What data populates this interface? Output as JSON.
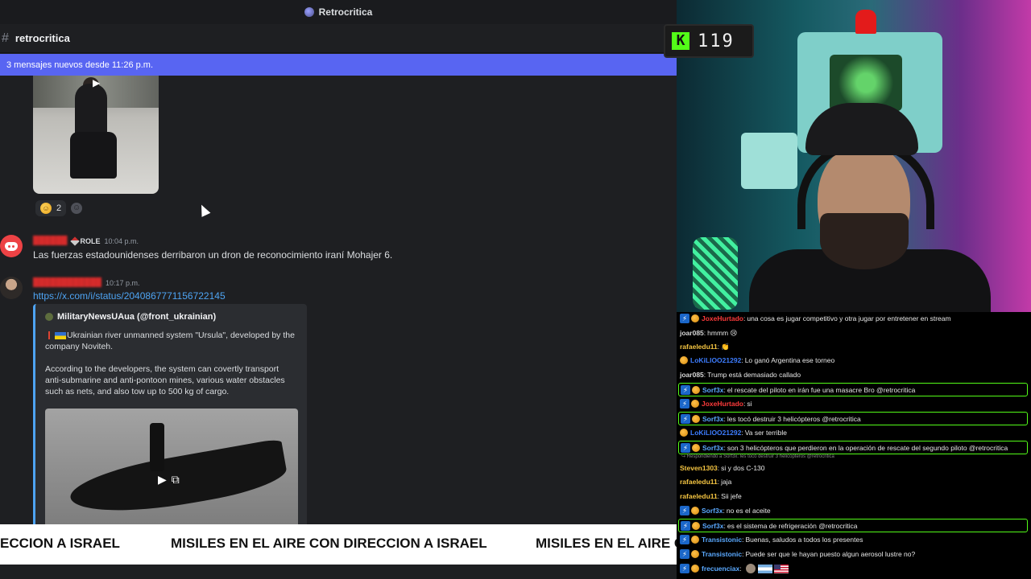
{
  "titlebar": {
    "title": "Retrocritica"
  },
  "channel": {
    "name": "retrocritica"
  },
  "new_banner": {
    "text": "3 mensajes nuevos desde 11:26 p.m."
  },
  "reactions": [
    {
      "emoji": "rofl",
      "count": "2"
    }
  ],
  "messages": [
    {
      "role": "ROLE",
      "time": "10:04 p.m.",
      "text": "Las fuerzas estadounidenses derribaron un dron de reconocimiento iraní Mohajer 6."
    },
    {
      "time": "10:17 p.m.",
      "link": "https://x.com/i/status/2040867771156722145",
      "embed": {
        "author": "MilitaryNewsUAua (@front_ukrainian)",
        "line1": "Ukrainian river unmanned system \"Ursula\", developed by the",
        "line2": "company Noviteh.",
        "para2_line1": "According to the developers, the system can covertly transport",
        "para2_line2": "anti-submarine and anti-pontoon mines, various water obstacles",
        "para2_line3": "such as nets, and also tow up to 500 kg of cargo."
      }
    }
  ],
  "ticker": {
    "segment1": "ECCION A ISRAEL",
    "segment2": "MISILES EN EL AIRE CON DIRECCION A ISRAEL",
    "segment3": "MISILES EN EL AIRE C"
  },
  "counter": {
    "icon": "K",
    "value": "119"
  },
  "chat": {
    "reply_note": "↪ Respondiendo a Sorf3x: les tocó destruir 3 helicópteros @retrocritica",
    "lines": [
      {
        "user": "JoxeHurtado",
        "color": "#ff3b3b",
        "badges": [
          "blue",
          "coin"
        ],
        "msg": "una cosa es jugar competitivo y otra jugar por entretener en stream",
        "hl": false
      },
      {
        "user": "joar085",
        "color": "#d8d8d8",
        "badges": [],
        "msg": "hmmm 😢",
        "hl": false
      },
      {
        "user": "rafaeledu11",
        "color": "#f5c542",
        "badges": [],
        "msg": "👏",
        "hl": false
      },
      {
        "user": "LoKiLlOO21292",
        "color": "#3d7dff",
        "badges": [
          "coin"
        ],
        "msg": "Lo ganó Argentina ese torneo",
        "hl": false
      },
      {
        "user": "joar085",
        "color": "#d8d8d8",
        "badges": [],
        "msg": "Trump está demasiado callado",
        "hl": false
      },
      {
        "user": "Sorf3x",
        "color": "#5aa9ff",
        "badges": [
          "blue",
          "coin"
        ],
        "msg": "el rescate del piloto en irán fue una masacre Bro @retrocritica",
        "hl": true
      },
      {
        "user": "JoxeHurtado",
        "color": "#ff3b3b",
        "badges": [
          "blue",
          "coin"
        ],
        "msg": "si",
        "hl": false
      },
      {
        "user": "Sorf3x",
        "color": "#5aa9ff",
        "badges": [
          "blue",
          "coin"
        ],
        "msg": "les tocó destruir 3 helicópteros @retrocritica",
        "hl": true
      },
      {
        "user": "LoKiLlOO21292",
        "color": "#3d7dff",
        "badges": [
          "coin"
        ],
        "msg": "Va ser terrible",
        "hl": false
      },
      {
        "user": "Sorf3x",
        "color": "#5aa9ff",
        "badges": [
          "blue",
          "coin"
        ],
        "msg": "son 3 helicópteros que perdieron en la operación de rescate del segundo piloto @retrocritica",
        "hl": true
      },
      {
        "user": "Steven1303",
        "color": "#f5c542",
        "badges": [],
        "msg": "si y dos C-130",
        "hl": false
      },
      {
        "user": "rafaeledu11",
        "color": "#f5c542",
        "badges": [],
        "msg": "jaja",
        "hl": false
      },
      {
        "user": "rafaeledu11",
        "color": "#f5c542",
        "badges": [],
        "msg": "Sii jefe",
        "hl": false
      },
      {
        "user": "Sorf3x",
        "color": "#5aa9ff",
        "badges": [
          "blue",
          "coin"
        ],
        "msg": "no es el aceite",
        "hl": false
      },
      {
        "user": "Sorf3x",
        "color": "#5aa9ff",
        "badges": [
          "blue",
          "coin"
        ],
        "msg": "es el sistema de refrigeración @retrocritica",
        "hl": true
      },
      {
        "user": "Transistonic",
        "color": "#5aa9ff",
        "badges": [
          "blue",
          "coin"
        ],
        "msg": "Buenas, saludos a todos los presentes",
        "hl": false
      },
      {
        "user": "Transistonic",
        "color": "#5aa9ff",
        "badges": [
          "blue",
          "coin"
        ],
        "msg": "Puede ser que le hayan puesto algun aerosol lustre no?",
        "hl": false
      },
      {
        "user": "frecuenciax",
        "color": "#5aa9ff",
        "badges": [
          "blue",
          "coin"
        ],
        "msg": "",
        "hl": false,
        "flags": true
      }
    ]
  },
  "colors": {
    "discord_bg": "#1e1f22",
    "banner": "#5865f2",
    "link": "#4ea4f3",
    "kick_green": "#53fc18"
  }
}
